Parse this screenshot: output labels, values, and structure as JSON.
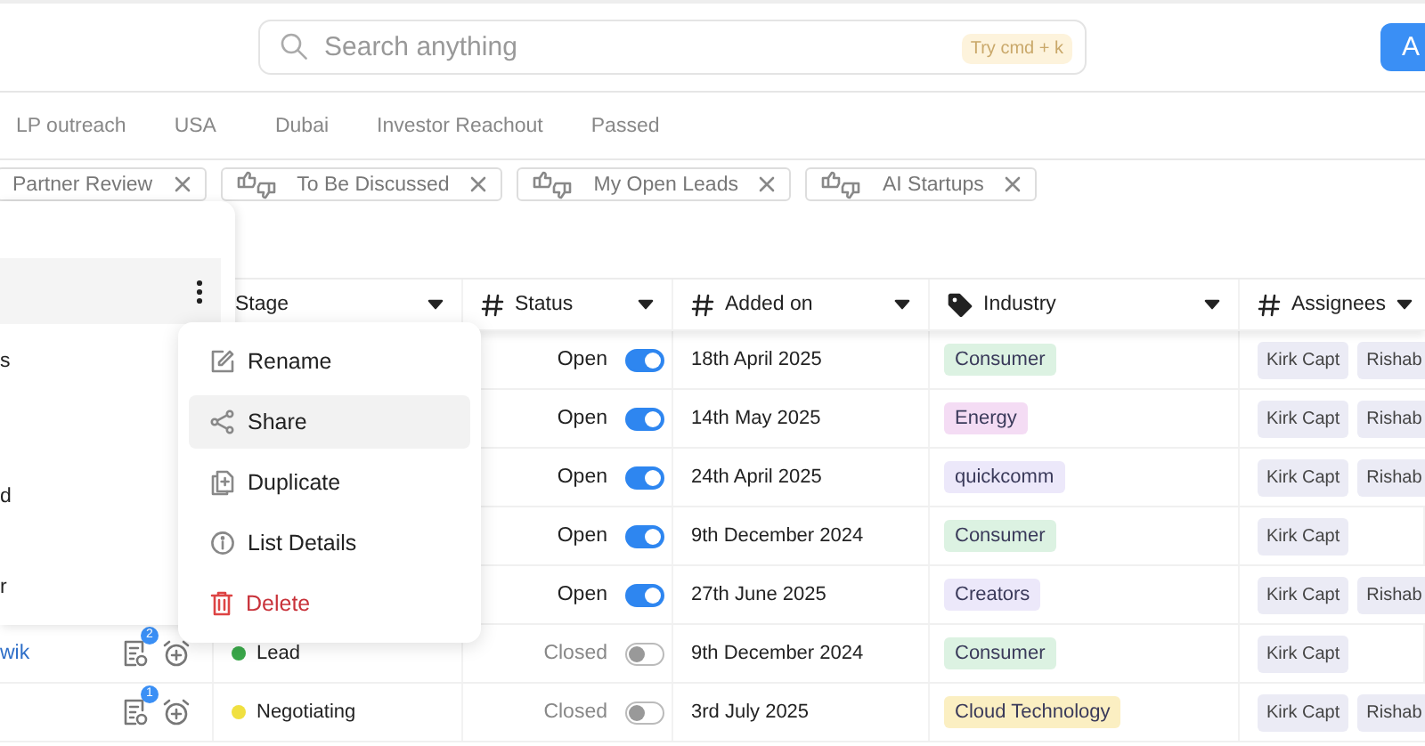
{
  "search": {
    "placeholder": "Search anything",
    "hint": "Try cmd + k"
  },
  "top_button": {
    "label": "A"
  },
  "tabs": [
    {
      "label": "LP outreach",
      "selected": false
    },
    {
      "label": "USA",
      "selected": false
    },
    {
      "label": "Dubai",
      "selected": false
    },
    {
      "label": "Investor Reachout",
      "selected": false
    },
    {
      "label": "Passed",
      "selected": false
    }
  ],
  "saved_views": [
    {
      "label": "Partner Review",
      "icon": false
    },
    {
      "label": "To Be Discussed",
      "icon": true
    },
    {
      "label": "My Open Leads",
      "icon": true
    },
    {
      "label": "AI Startups",
      "icon": true
    }
  ],
  "table": {
    "columns": [
      {
        "label": "Stage"
      },
      {
        "label": "Status"
      },
      {
        "label": "Added on"
      },
      {
        "label": "Industry"
      },
      {
        "label": "Assignees"
      }
    ],
    "rows": [
      {
        "status": {
          "label": "Open",
          "on": true
        },
        "added": "18th April 2025",
        "industry": {
          "label": "Consumer",
          "color": "#dcf2e2"
        },
        "assignees": [
          "Kirk Capt",
          "Rishab"
        ]
      },
      {
        "status": {
          "label": "Open",
          "on": true
        },
        "added": "14th May 2025",
        "industry": {
          "label": "Energy",
          "color": "#f4dcf4"
        },
        "assignees": [
          "Kirk Capt",
          "Rishab"
        ]
      },
      {
        "status": {
          "label": "Open",
          "on": true
        },
        "added": "24th April 2025",
        "industry": {
          "label": "quickcomm",
          "color": "#ece8fa"
        },
        "assignees": [
          "Kirk Capt",
          "Rishab"
        ]
      },
      {
        "status": {
          "label": "Open",
          "on": true
        },
        "added": "9th December 2024",
        "industry": {
          "label": "Consumer",
          "color": "#dcf2e2"
        },
        "assignees": [
          "Kirk Capt"
        ]
      },
      {
        "status": {
          "label": "Open",
          "on": true
        },
        "added": "27th June 2025",
        "industry": {
          "label": "Creators",
          "color": "#ece8fa"
        },
        "assignees": [
          "Kirk Capt",
          "Rishab"
        ]
      },
      {
        "name": "wik",
        "notes_count": "2",
        "stage": {
          "label": "Lead",
          "color": "#3aa84a"
        },
        "status": {
          "label": "Closed",
          "on": false
        },
        "added": "9th December 2024",
        "industry": {
          "label": "Consumer",
          "color": "#dcf2e2"
        },
        "assignees": [
          "Kirk Capt"
        ]
      },
      {
        "notes_count": "1",
        "stage": {
          "label": "Negotiating",
          "color": "#f0e040"
        },
        "status": {
          "label": "Closed",
          "on": false
        },
        "added": "3rd July 2025",
        "industry": {
          "label": "Cloud Technology",
          "color": "#fbefc2"
        },
        "assignees": [
          "Kirk Capt",
          "Rishab"
        ]
      }
    ]
  },
  "lists_panel": {
    "items": [
      {
        "selected": true
      },
      {
        "label": "s",
        "selected": false
      },
      {
        "label": "d",
        "selected": false
      },
      {
        "label": "r",
        "selected": false
      }
    ]
  },
  "context_menu": {
    "items": [
      {
        "label": "Rename",
        "kind": "rename",
        "highlighted": false
      },
      {
        "label": "Share",
        "kind": "share",
        "highlighted": true
      },
      {
        "label": "Duplicate",
        "kind": "duplicate",
        "highlighted": false
      },
      {
        "label": "List Details",
        "kind": "details",
        "highlighted": false
      },
      {
        "label": "Delete",
        "kind": "delete",
        "highlighted": false
      }
    ]
  }
}
